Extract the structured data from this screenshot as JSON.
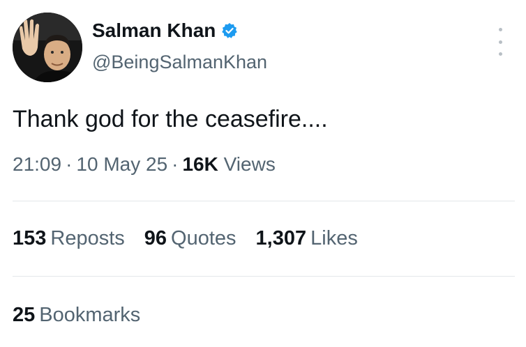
{
  "author": {
    "display_name": "Salman Khan",
    "handle": "@BeingSalmanKhan",
    "verified": true,
    "verified_color": "#1d9bf0",
    "avatar_icon": "profile-photo-waving"
  },
  "tweet": {
    "text": "Thank god for the ceasefire....",
    "time": "21:09",
    "date": "10 May 25",
    "separator": "·",
    "views_count": "16K",
    "views_label": "Views"
  },
  "stats": [
    {
      "count": "153",
      "label": "Reposts"
    },
    {
      "count": "96",
      "label": "Quotes"
    },
    {
      "count": "1,307",
      "label": "Likes"
    }
  ],
  "bookmarks": {
    "count": "25",
    "label": "Bookmarks"
  },
  "colors": {
    "text_primary": "#0f1419",
    "text_secondary": "#536471",
    "divider": "#e3e7ea"
  }
}
